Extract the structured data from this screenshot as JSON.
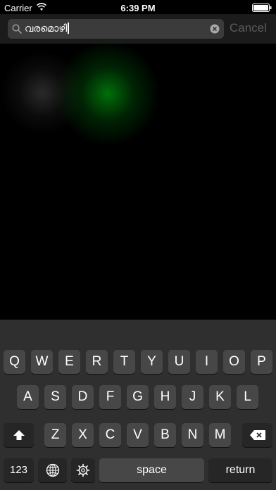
{
  "status_bar": {
    "carrier": "Carrier",
    "wifi_icon": "wifi-icon",
    "time": "6:39 PM",
    "battery_icon": "battery-icon"
  },
  "search": {
    "value": "വരമൊഴി",
    "search_icon": "search-icon",
    "clear_icon": "clear-icon",
    "cancel_label": "Cancel"
  },
  "colors": {
    "glow_green": "#008a0a",
    "glow_gray": "#787878",
    "keyboard_bg": "#2f2f2f",
    "key_bg": "#474747",
    "func_key_bg": "#262626",
    "cancel_text": "#5b5b5b"
  },
  "keyboard": {
    "row1": [
      "Q",
      "W",
      "E",
      "R",
      "T",
      "Y",
      "U",
      "I",
      "O",
      "P"
    ],
    "row2": [
      "A",
      "S",
      "D",
      "F",
      "G",
      "H",
      "J",
      "K",
      "L"
    ],
    "row3": [
      "Z",
      "X",
      "C",
      "V",
      "B",
      "N",
      "M"
    ],
    "shift_icon": "shift-icon",
    "delete_icon": "delete-icon",
    "numbers_label": "123",
    "globe_icon": "globe-icon",
    "settings_icon": "gear-icon",
    "space_label": "space",
    "return_label": "return"
  }
}
